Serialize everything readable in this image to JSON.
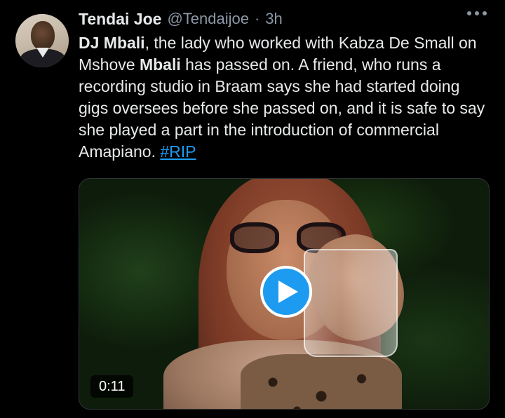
{
  "tweet": {
    "author_name": "Tendai Joe",
    "author_handle": "@Tendaijoe",
    "separator": "·",
    "time": "3h",
    "text_parts": [
      {
        "bold": true,
        "text": "DJ Mbali"
      },
      {
        "bold": false,
        "text": ", the lady who worked with Kabza De Small on Mshove "
      },
      {
        "bold": true,
        "text": "Mbali"
      },
      {
        "bold": false,
        "text": " has passed on. A friend, who runs a recording studio in Braam says she had started doing gigs oversees before she passed on, and it is safe to say she played a part in the introduction of commercial Amapiano. "
      }
    ],
    "hashtag": "#RIP"
  },
  "media": {
    "duration": "0:11",
    "play_icon": "play-icon"
  },
  "icons": {
    "more": "more-horizontal-icon"
  },
  "colors": {
    "background": "#000000",
    "text": "#e7e9ea",
    "secondary": "#8b98a5",
    "accent": "#1d9bf0"
  }
}
